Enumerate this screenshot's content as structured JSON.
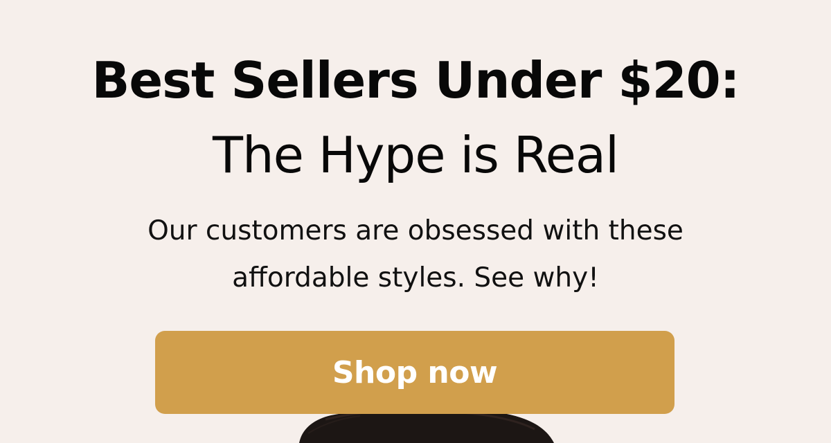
{
  "banner": {
    "headline_line_1": "Best Sellers Under $20:",
    "headline_line_2": "The Hype is Real",
    "subhead_line_1": "Our customers are obsessed with these",
    "subhead_line_2": "affordable styles. See why!",
    "cta_label": "Shop now",
    "photo_subject": "model-hair-photo"
  },
  "colors": {
    "background": "#f6efeb",
    "text": "#080808",
    "cta_background": "#d19f4c",
    "cta_text": "#ffffff",
    "hair": "#1c1614"
  }
}
